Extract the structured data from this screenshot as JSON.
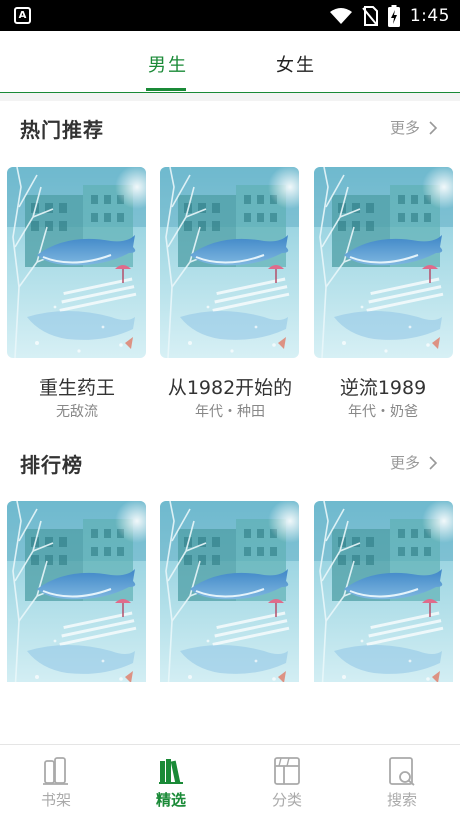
{
  "status_bar": {
    "app_badge": "A",
    "time": "1:45"
  },
  "tabs": [
    {
      "label": "男生",
      "active": true
    },
    {
      "label": "女生",
      "active": false
    }
  ],
  "sections": {
    "hot": {
      "title": "热门推荐",
      "more": "更多",
      "books": [
        {
          "title": "重生药王",
          "subtitle": "无敌流"
        },
        {
          "title": "从1982开始的",
          "subtitle": "年代・种田"
        },
        {
          "title": "逆流1989",
          "subtitle": "年代・奶爸"
        }
      ]
    },
    "ranking": {
      "title": "排行榜",
      "more": "更多"
    }
  },
  "bottom_nav": [
    {
      "label": "书架",
      "icon": "bookshelf-icon",
      "active": false
    },
    {
      "label": "精选",
      "icon": "featured-books-icon",
      "active": true
    },
    {
      "label": "分类",
      "icon": "category-icon",
      "active": false
    },
    {
      "label": "搜索",
      "icon": "search-book-icon",
      "active": false
    }
  ],
  "colors": {
    "accent": "#1a8a37",
    "status_bar": "#000000",
    "muted_text": "#999999"
  }
}
